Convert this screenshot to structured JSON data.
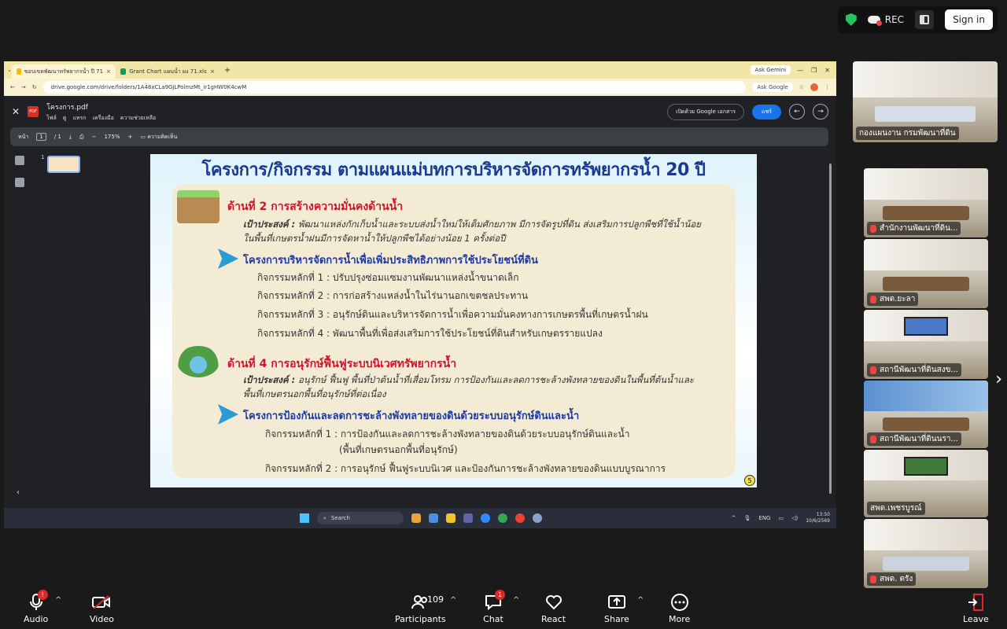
{
  "top": {
    "rec_label": "REC",
    "signin_label": "Sign in"
  },
  "browser": {
    "tabs": [
      {
        "title": "ขอบเขตพัฒนาทรัพยากรน้ำ ปี 71 - Google ไ"
      },
      {
        "title": "Grant Chart แผนน้ำ ผง 71.xlsx - "
      }
    ],
    "gemini_label": "Ask Gemini",
    "url": "drive.google.com/drive/folders/1A48xCLa9GjLPolmzMt_ir1gHW0K4cwM",
    "ask_google": "Ask Google"
  },
  "viewer": {
    "file_name": "โครงการ.pdf",
    "menu": [
      "ไฟล์",
      "ดู",
      "แทรก",
      "เครื่องมือ",
      "ความช่วยเหลือ"
    ],
    "open_with": "เปิดด้วย Google เอกสาร",
    "share": "แชร์",
    "page_label": "หน้า",
    "page_current": "1",
    "page_total": "/ 1",
    "zoom": "175%",
    "comment": "ความคิดเห็น",
    "thumb_number": "1"
  },
  "slide": {
    "title": "โครงการ/กิจกรรม ตามแผนแม่บทการบริหารจัดการทรัพยากรน้ำ 20 ปี",
    "sections": [
      {
        "heading": "ด้านที่ 2 การสร้างความมั่นคงด้านน้ำ",
        "objective_label": "เป้าประสงค์ :",
        "objective_text": "พัฒนาแหล่งกักเก็บน้ำและระบบส่งน้ำใหม่ให้เต็มศักยภาพ มีการจัดรูปที่ดิน ส่งเสริมการปลูกพืชที่ใช้น้ำน้อย",
        "objective_text2": "ในพื้นที่เกษตรน้ำฝนมีการจัดหาน้ำให้ปลูกพืชได้อย่างน้อย 1 ครั้งต่อปี",
        "project": "โครงการบริหารจัดการน้ำเพื่อเพิ่มประสิทธิภาพการใช้ประโยชน์ที่ดิน",
        "activities": [
          "กิจกรรมหลักที่ 1 : ปรับปรุงซ่อมแซมงานพัฒนาแหล่งน้ำขนาดเล็ก",
          "กิจกรรมหลักที่ 2 : การก่อสร้างแหล่งน้ำในไร่นานอกเขตชลประทาน",
          "กิจกรรมหลักที่ 3 : อนุรักษ์ดินและบริหารจัดการน้ำเพื่อความมั่นคงทางการเกษตรพื้นที่เกษตรน้ำฝน",
          "กิจกรรมหลักที่ 4 : พัฒนาพื้นที่เพื่อส่งเสริมการใช้ประโยชน์ที่ดินสำหรับเกษตรรายแปลง"
        ]
      },
      {
        "heading": "ด้านที่ 4 การอนุรักษ์ฟื้นฟูระบบนิเวศทรัพยากรน้ำ",
        "objective_label": "เป้าประสงค์ :",
        "objective_text": "อนุรักษ์ ฟื้นฟู พื้นที่ป่าต้นน้ำที่เสื่อมโทรม การป้องกันและลดการชะล้างพังทลายของดินในพื้นที่ต้นน้ำและ",
        "objective_text2": "พื้นที่เกษตรนอกพื้นที่อนุรักษ์ที่ต่อเนื่อง",
        "project": "โครงการป้องกันและลดการชะล้างพังทลายของดินด้วยระบบอนุรักษ์ดินและน้ำ",
        "activities": [
          "กิจกรรมหลักที่ 1 : การป้องกันและลดการชะล้างพังทลายของดินด้วยระบบอนุรักษ์ดินและน้ำ",
          "(พื้นที่เกษตรนอกพื้นที่อนุรักษ์)",
          "กิจกรรมหลักที่ 2 : การอนุรักษ์ ฟื้นฟูระบบนิเวศ และป้องกันการชะล้างพังทลายของดินแบบบูรณาการ"
        ]
      }
    ],
    "page_number": "5"
  },
  "taskbar": {
    "search": "Search",
    "lang": "ENG",
    "time": "13:50",
    "date": "10/6/2569"
  },
  "participants": [
    "กองแผนงาน กรมพัฒนาที่ดิน",
    "สำนักงานพัฒนาที่ดิน...",
    "สพด.ยะลา",
    "สถานีพัฒนาที่ดินสงข...",
    "สถานีพัฒนาที่ดินนรา...",
    "สพด.เพชรบูรณ์",
    "สพด. ตรัง"
  ],
  "bottom": {
    "audio": "Audio",
    "video": "Video",
    "participants": "Participants",
    "participants_count": "109",
    "chat": "Chat",
    "chat_badge": "1",
    "react": "React",
    "share": "Share",
    "more": "More",
    "leave": "Leave",
    "audio_badge": "!"
  }
}
